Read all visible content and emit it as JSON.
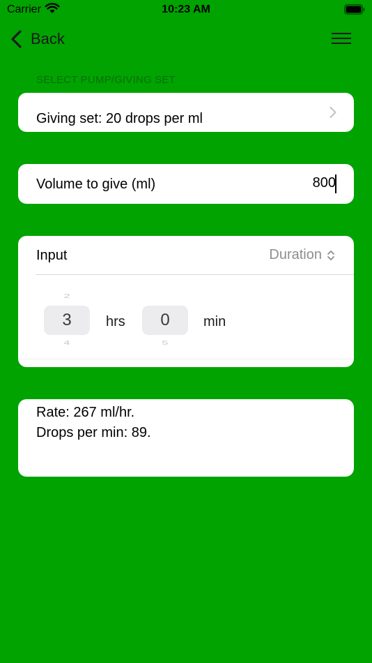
{
  "status_bar": {
    "carrier": "Carrier",
    "time": "10:23 AM",
    "wifi_icon": "wifi-icon",
    "battery_icon": "battery-icon"
  },
  "nav": {
    "back_label": "Back",
    "back_icon": "chevron-left-icon",
    "menu_icon": "hamburger-menu-icon"
  },
  "section_header": "SELECT PUMP/GIVING SET",
  "giving_set": {
    "label": "Giving set: 20 drops per ml",
    "icon": "chevron-right-icon"
  },
  "volume": {
    "label": "Volume to give (ml)",
    "value": "800"
  },
  "input": {
    "label": "Input",
    "mode_selected": "Duration",
    "mode_icon": "chevron-up-down-icon",
    "hours": {
      "prev": "2",
      "value": "3",
      "next": "4",
      "unit": "hrs"
    },
    "minutes": {
      "value": "0",
      "next": "5",
      "unit": "min"
    }
  },
  "result": {
    "rate": "Rate: 267 ml/hr.",
    "drops": "Drops per min: 89."
  },
  "colors": {
    "background": "#00a300",
    "card": "#ffffff",
    "secondary_text": "#8e8e93"
  }
}
